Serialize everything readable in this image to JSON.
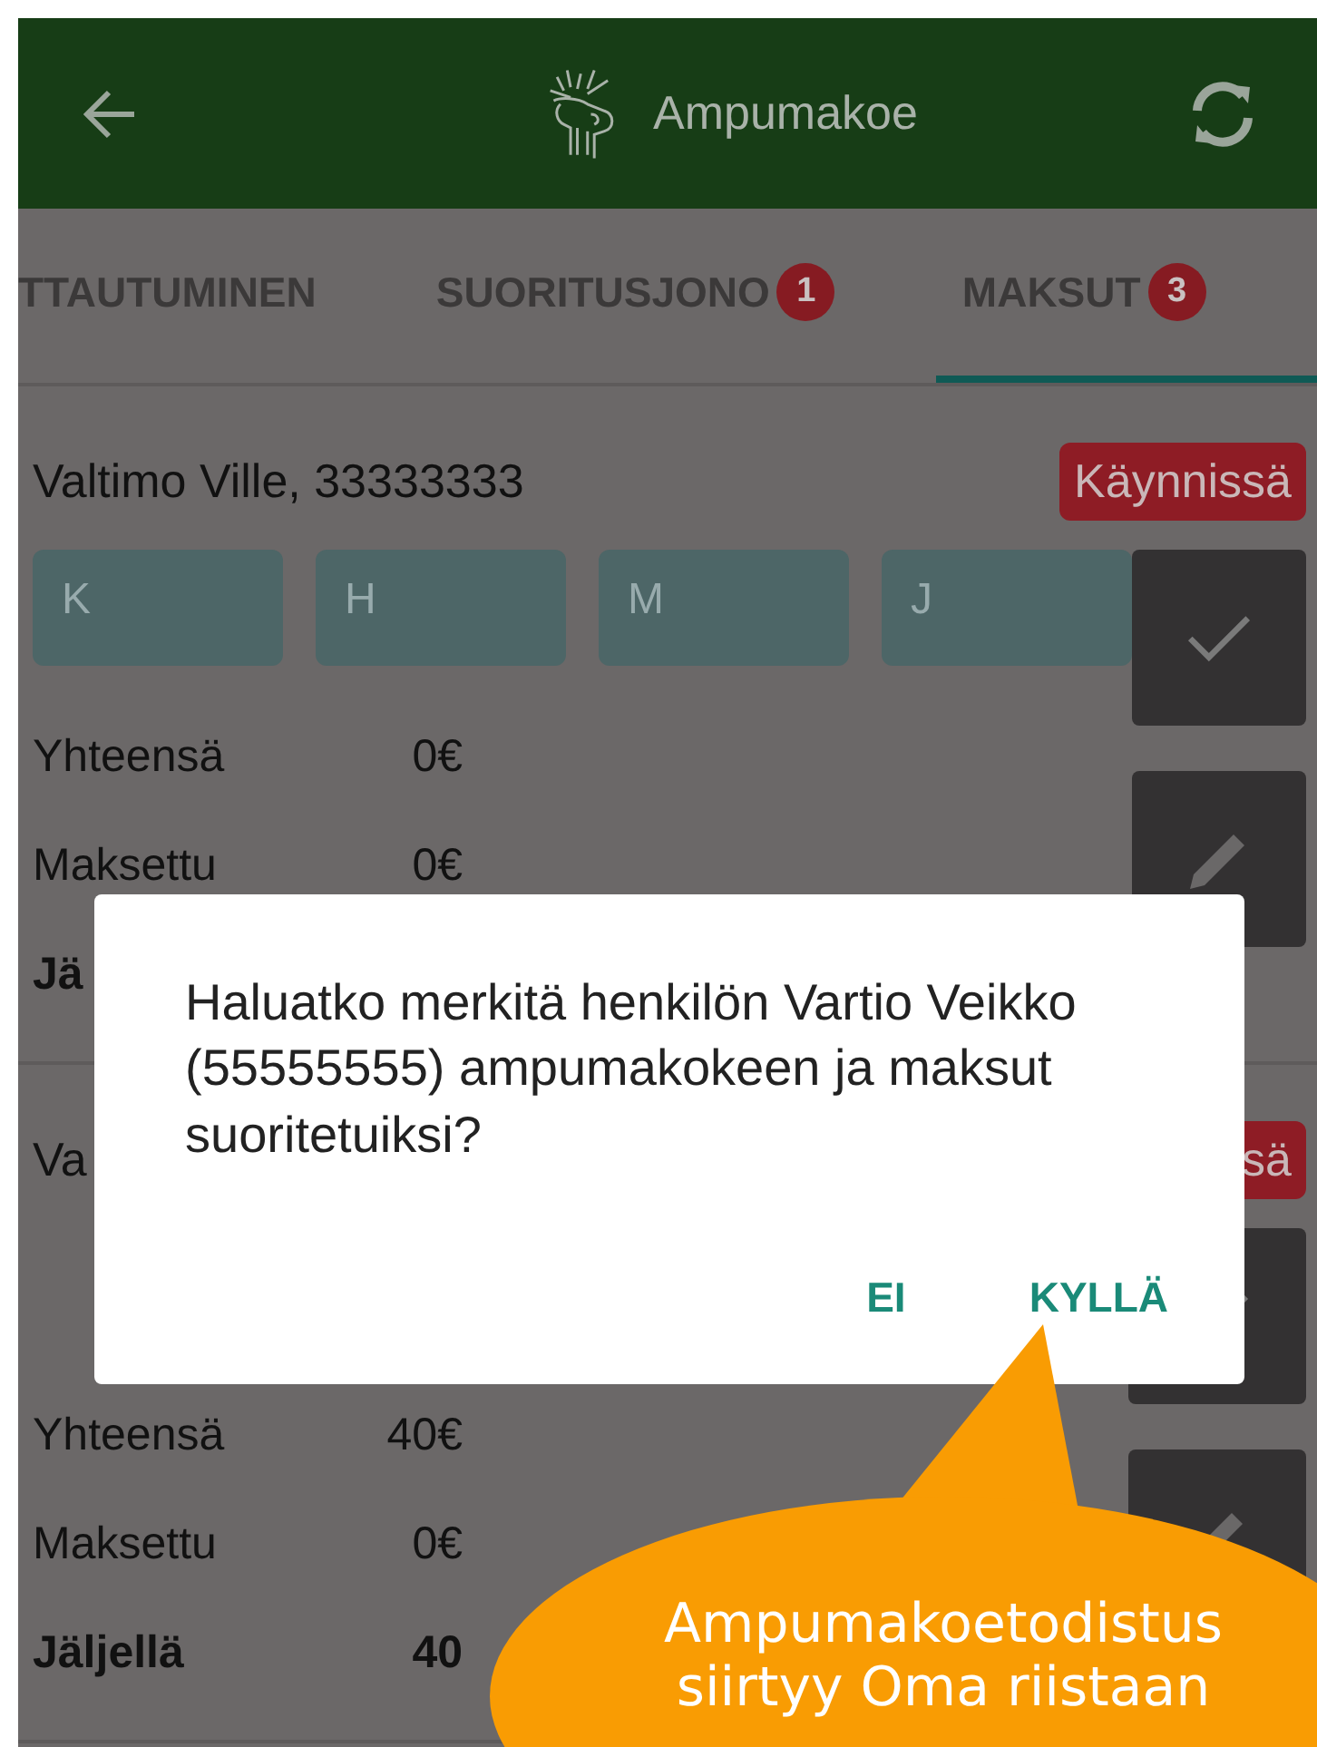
{
  "app_bar": {
    "title": "Ampumakoe"
  },
  "tabs": [
    {
      "label": "TTAUTUMINEN",
      "selected": false
    },
    {
      "label": "SUORITUSJONO",
      "badge": "1",
      "selected": false
    },
    {
      "label": "MAKSUT",
      "badge": "3",
      "selected": true
    }
  ],
  "cards": [
    {
      "name": "Valtimo Ville, 33333333",
      "status": "Käynnissä",
      "chips": [
        "K",
        "H",
        "M",
        "J"
      ],
      "rows": [
        {
          "label": "Yhteensä",
          "value": "0€",
          "bold": false
        },
        {
          "label": "Maksettu",
          "value": "0€",
          "bold": false
        },
        {
          "label": "Jä",
          "bold": true
        }
      ]
    },
    {
      "name": "Va",
      "status": "sä",
      "rows": [
        {
          "label": "Yhteensä",
          "value": "40€",
          "bold": false
        },
        {
          "label": "Maksettu",
          "value": "0€",
          "bold": false
        },
        {
          "label": "Jäljellä",
          "value": "40",
          "bold": true
        }
      ]
    }
  ],
  "dialog": {
    "message": "Haluatko merkitä henkilön Vartio Veikko (55555555) ampumakokeen ja maksut suoritetuiksi?",
    "buttons": [
      "EI",
      "KYLLÄ"
    ]
  },
  "callout": {
    "text": "Ampumakoetodistus siirtyy Oma riistaan"
  }
}
